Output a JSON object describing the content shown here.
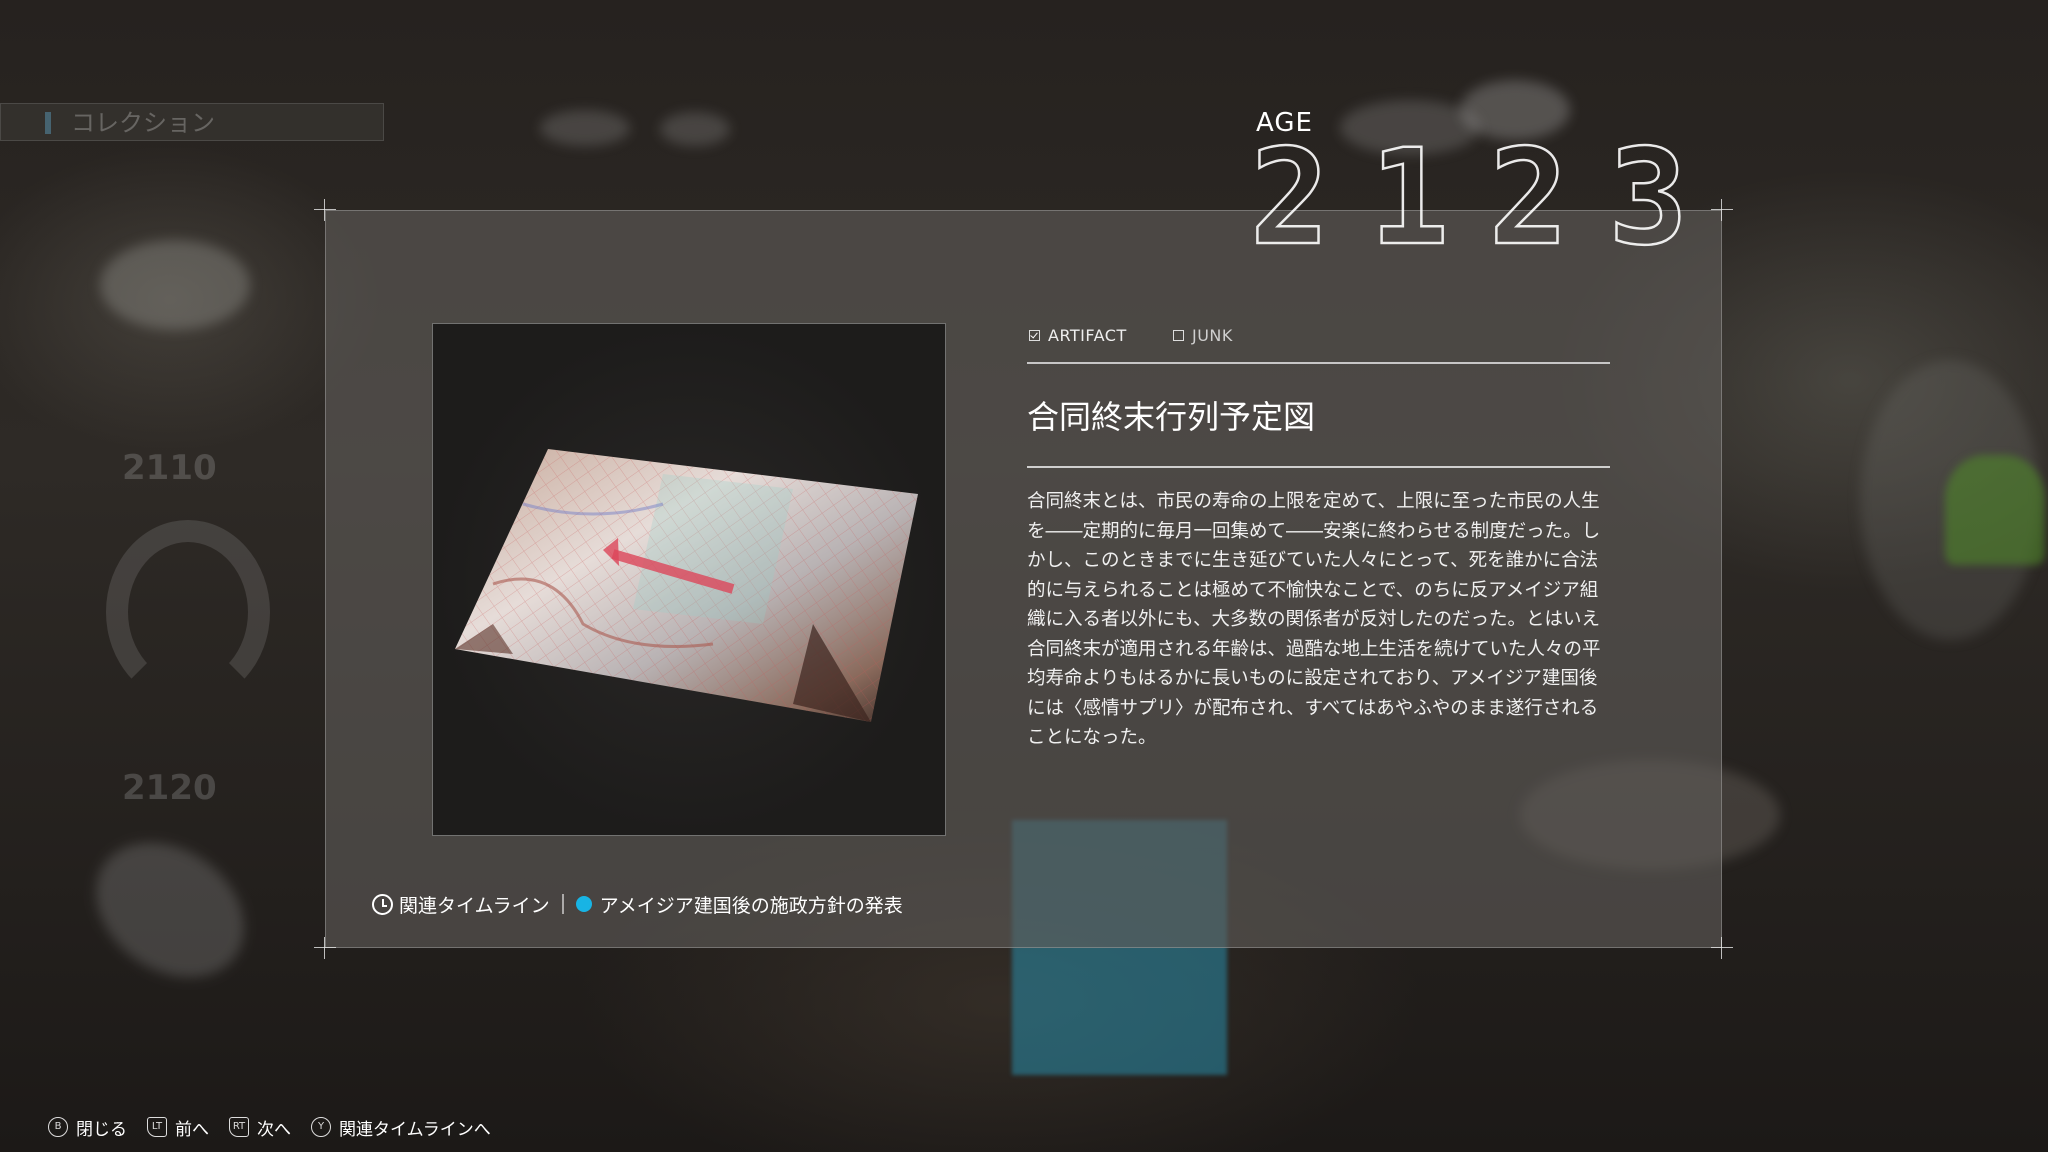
{
  "age": {
    "label": "AGE",
    "digits": [
      "2",
      "1",
      "2",
      "3"
    ]
  },
  "background": {
    "collection_tab_label": "コレクション",
    "side_years": [
      "2110",
      "2120"
    ]
  },
  "filters": [
    {
      "label": "ARTIFACT",
      "checked": true
    },
    {
      "label": "JUNK",
      "checked": false
    }
  ],
  "item": {
    "title": "合同終末行列予定図",
    "description": "合同終末とは、市民の寿命の上限を定めて、上限に至った市民の人生を――定期的に毎月一回集めて――安楽に終わらせる制度だった。しかし、このときまでに生き延びていた人々にとって、死を誰かに合法的に与えられることは極めて不愉快なことで、のちに反アメイジア組織に入る者以外にも、大多数の関係者が反対したのだった。とはいえ合同終末が適用される年齢は、過酷な地上生活を続けていた人々の平均寿命よりもはるかに長いものに設定されており、アメイジア建国後には〈感情サプリ〉が配布され、すべてはあやふやのまま遂行されることになった。",
    "image_icon": "crumpled-map"
  },
  "timeline": {
    "label": "関連タイムライン",
    "entry": "アメイジア建国後の施政方針の発表",
    "dot_color": "#18b4e4"
  },
  "controls": [
    {
      "glyph": "B",
      "label": "閉じる",
      "icon": "b-button-icon"
    },
    {
      "glyph": "LT",
      "label": "前へ",
      "icon": "lt-trigger-icon"
    },
    {
      "glyph": "RT",
      "label": "次へ",
      "icon": "rt-trigger-icon"
    },
    {
      "glyph": "Y",
      "label": "関連タイムラインへ",
      "icon": "y-button-icon"
    }
  ],
  "colors": {
    "accent": "#18b4e4",
    "panel": "#5f5c58"
  }
}
